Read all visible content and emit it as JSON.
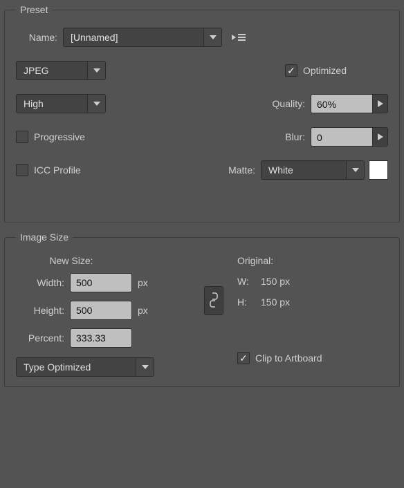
{
  "preset": {
    "legend": "Preset",
    "name_label": "Name:",
    "name_value": "[Unnamed]",
    "format": "JPEG",
    "optimized_label": "Optimized",
    "optimized_checked": true,
    "quality_preset": "High",
    "quality_label": "Quality:",
    "quality_value": "60%",
    "progressive_label": "Progressive",
    "progressive_checked": false,
    "blur_label": "Blur:",
    "blur_value": "0",
    "icc_label": "ICC Profile",
    "icc_checked": false,
    "matte_label": "Matte:",
    "matte_value": "White",
    "matte_swatch": "#ffffff"
  },
  "image_size": {
    "legend": "Image Size",
    "new_size_label": "New Size:",
    "width_label": "Width:",
    "width_value": "500",
    "width_unit": "px",
    "height_label": "Height:",
    "height_value": "500",
    "height_unit": "px",
    "percent_label": "Percent:",
    "percent_value": "333.33",
    "resample": "Type Optimized",
    "clip_label": "Clip to Artboard",
    "clip_checked": true,
    "original_label": "Original:",
    "orig_w_label": "W:",
    "orig_w_value": "150 px",
    "orig_h_label": "H:",
    "orig_h_value": "150 px"
  }
}
